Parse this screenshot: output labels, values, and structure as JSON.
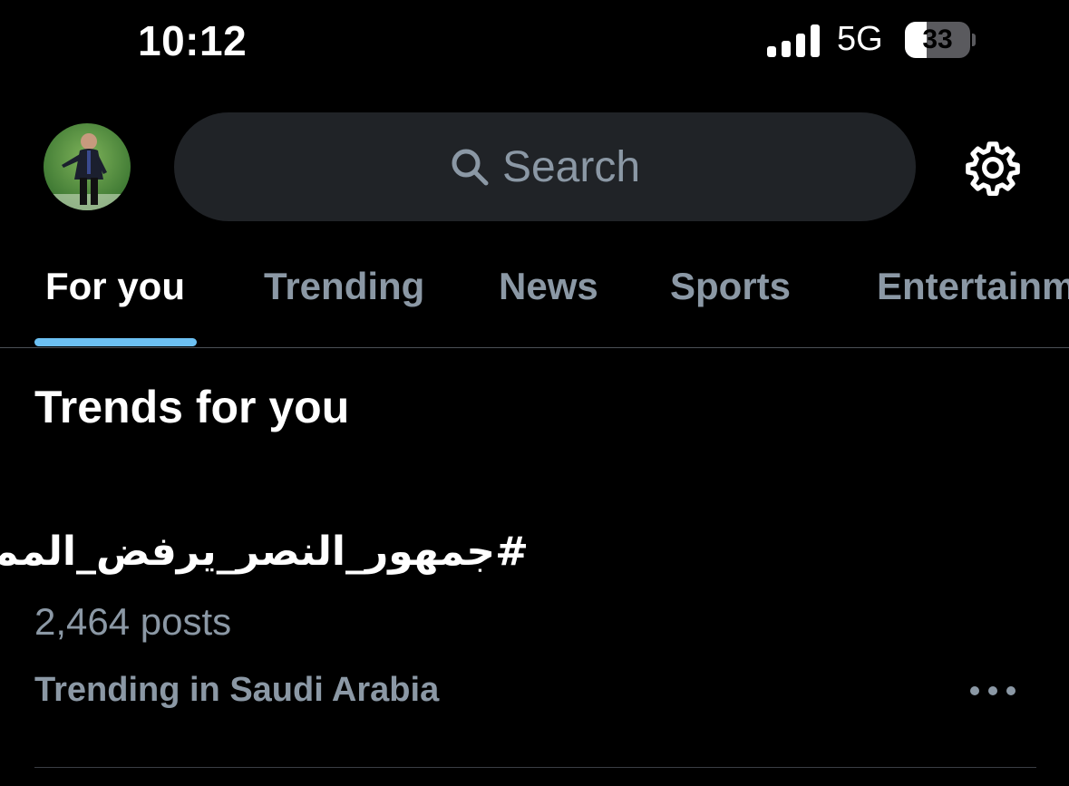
{
  "status_bar": {
    "time": "10:12",
    "network": "5G",
    "battery_percent": "33",
    "battery_level": 0.33,
    "signal_bars": 4
  },
  "header": {
    "avatar_icon": "profile-avatar",
    "search_placeholder": "Search",
    "search_icon": "search-icon",
    "settings_icon": "gear-icon"
  },
  "tabs": [
    {
      "label": "For you",
      "active": true
    },
    {
      "label": "Trending",
      "active": false
    },
    {
      "label": "News",
      "active": false
    },
    {
      "label": "Sports",
      "active": false
    },
    {
      "label": "Entertainment",
      "active": false
    }
  ],
  "section_title": "Trends for you",
  "trends": [
    {
      "hashtag": "#جمهور_النصر_يرفض_الممر",
      "posts": "2,464 posts",
      "context": "Trending in Saudi Arabia",
      "more_icon": "more-icon"
    }
  ],
  "colors": {
    "background": "#000000",
    "accent": "#6cc0f2",
    "muted_text": "#8b98a5",
    "search_bg": "#202327"
  }
}
